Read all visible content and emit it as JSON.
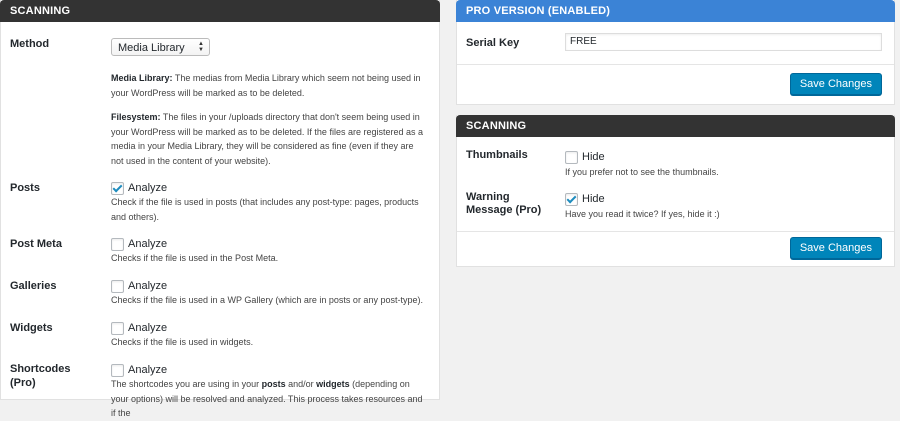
{
  "left": {
    "header": "SCANNING",
    "method": {
      "label": "Method",
      "selected": "Media Library",
      "desc1_bold": "Media Library:",
      "desc1_rest": " The medias from Media Library which seem not being used in your WordPress will be marked as to be deleted.",
      "desc2_bold": "Filesystem:",
      "desc2_rest": " The files in your /uploads directory that don't seem being used in your WordPress will be marked as to be deleted. If the files are registered as a media in your Media Library, they will be considered as fine (even if they are not used in the content of your website)."
    },
    "options": [
      {
        "label": "Posts",
        "checkbox": "Analyze",
        "checked": true,
        "desc": "Check if the file is used in posts (that includes any post-type: pages, products and others)."
      },
      {
        "label": "Post Meta",
        "checkbox": "Analyze",
        "checked": false,
        "desc": "Checks if the file is used in the Post Meta."
      },
      {
        "label": "Galleries",
        "checkbox": "Analyze",
        "checked": false,
        "desc": "Checks if the file is used in a WP Gallery (which are in posts or any post-type)."
      },
      {
        "label": "Widgets",
        "checkbox": "Analyze",
        "checked": false,
        "desc": "Checks if the file is used in widgets."
      },
      {
        "label": "Shortcodes (Pro)",
        "checkbox": "Analyze",
        "checked": false
      }
    ],
    "shortcodes_desc": {
      "a": "The shortcodes you are using in your ",
      "b": "posts",
      "c": " and/or ",
      "d": "widgets",
      "e": " (depending on your options) will be resolved and analyzed. This process takes resources and if the"
    }
  },
  "pro": {
    "header": "PRO VERSION (ENABLED)",
    "serial_label": "Serial Key",
    "serial_value": "FREE",
    "save_label": "Save Changes"
  },
  "right": {
    "header": "SCANNING",
    "thumbnails": {
      "label": "Thumbnails",
      "checkbox": "Hide",
      "checked": false,
      "desc": "If you prefer not to see the thumbnails."
    },
    "warning": {
      "label": "Warning Message (Pro)",
      "checkbox": "Hide",
      "checked": true,
      "desc": "Have you read it twice? If yes, hide it :)"
    },
    "save_label": "Save Changes"
  },
  "colors": {
    "accent": "#0085ba",
    "header_dark": "#333333",
    "header_blue": "#3b83d6"
  }
}
